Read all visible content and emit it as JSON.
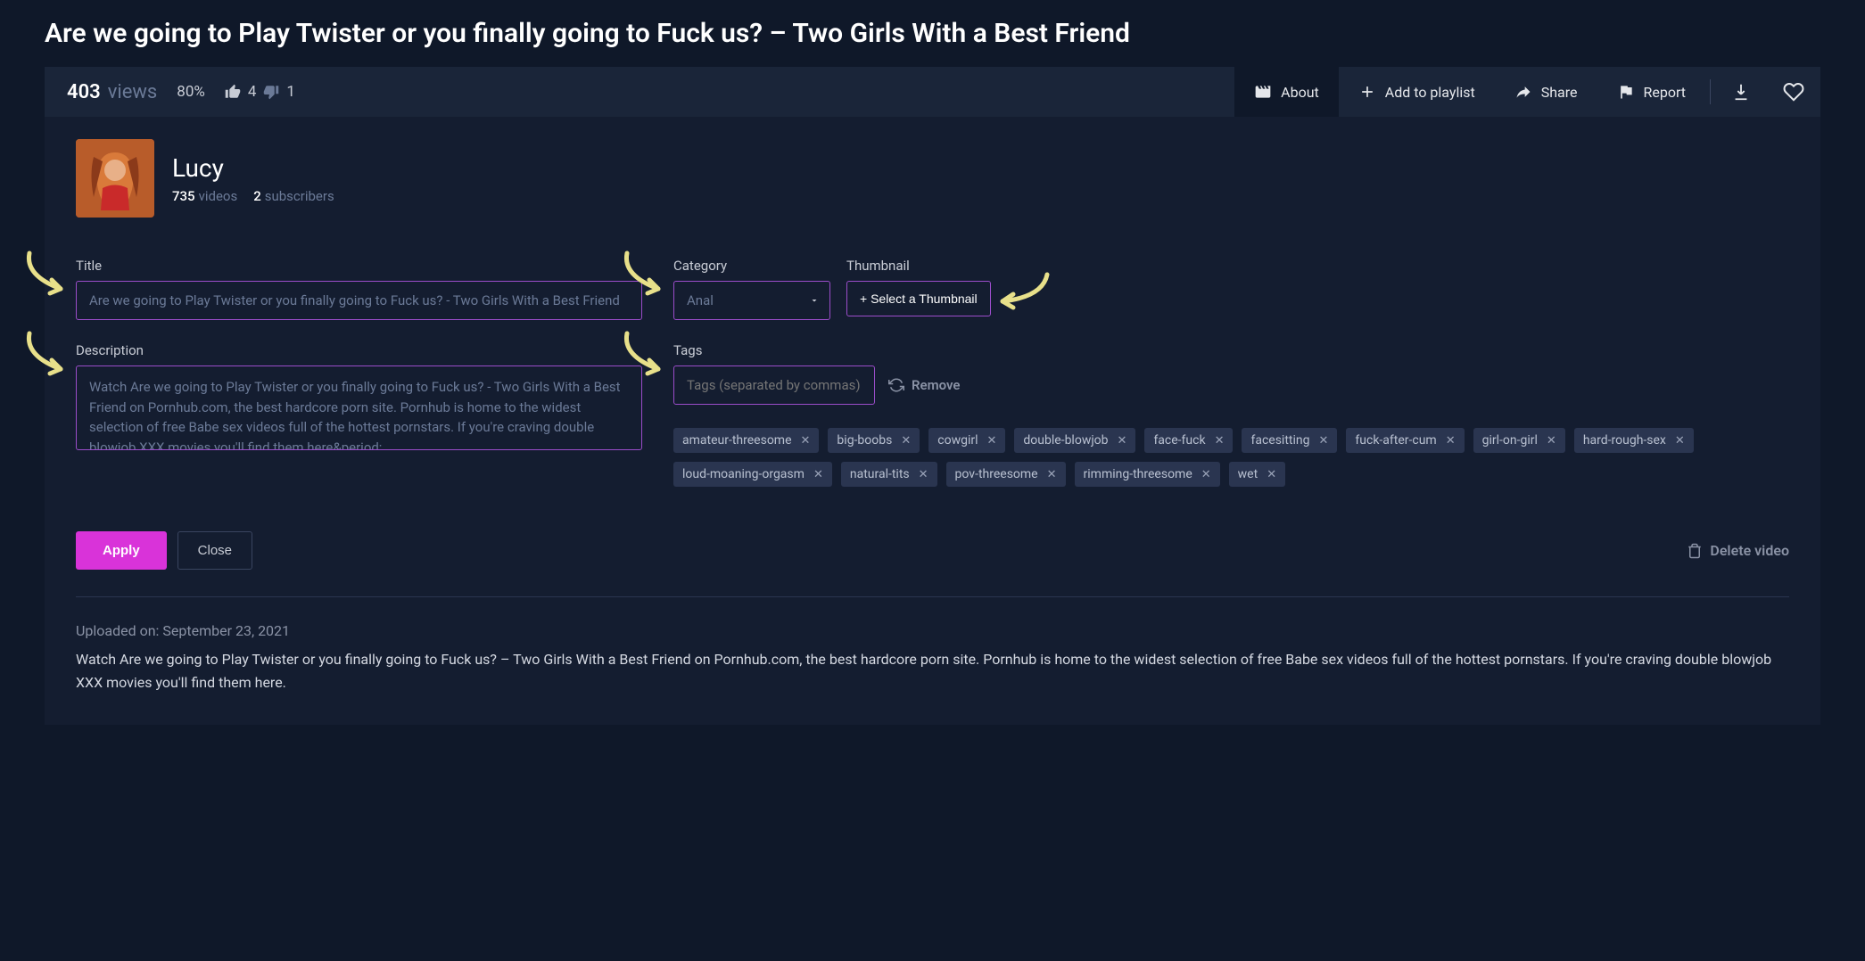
{
  "page": {
    "title": "Are we going to Play Twister or you finally going to Fuck us? – Two Girls With a Best Friend"
  },
  "stats": {
    "views_count": "403",
    "views_label": "views",
    "percent": "80%",
    "likes": "4",
    "dislikes": "1"
  },
  "tabs": {
    "about": "About",
    "add_playlist": "Add to playlist",
    "share": "Share",
    "report": "Report"
  },
  "author": {
    "name": "Lucy",
    "videos_count": "735",
    "videos_label": "videos",
    "subs_count": "2",
    "subs_label": "subscribers"
  },
  "form": {
    "title_label": "Title",
    "title_value": "Are we going to Play Twister or you finally going to Fuck us? - Two Girls With a Best Friend",
    "desc_label": "Description",
    "desc_value": "Watch Are we going to Play Twister or you finally going to Fuck us? - Two Girls With a Best Friend on Pornhub.com, the best hardcore porn site. Pornhub is home to the widest selection of free Babe sex videos full of the hottest pornstars. If you're craving double blowjob XXX movies you'll find them here&period;",
    "category_label": "Category",
    "category_value": "Anal",
    "thumb_label": "Thumbnail",
    "thumb_button": "+ Select a Thumbnail",
    "tags_label": "Tags",
    "tags_placeholder": "Tags (separated by commas)",
    "remove_label": "Remove",
    "tags": [
      "amateur-threesome",
      "big-boobs",
      "cowgirl",
      "double-blowjob",
      "face-fuck",
      "facesitting",
      "fuck-after-cum",
      "girl-on-girl",
      "hard-rough-sex",
      "loud-moaning-orgasm",
      "natural-tits",
      "pov-threesome",
      "rimming-threesome",
      "wet"
    ]
  },
  "actions": {
    "apply": "Apply",
    "close": "Close",
    "delete": "Delete video"
  },
  "meta": {
    "uploaded": "Uploaded on: September 23, 2021",
    "description": "Watch Are we going to Play Twister or you finally going to Fuck us? – Two Girls With a Best Friend on Pornhub.com, the best hardcore porn site. Pornhub is home to the widest selection of free Babe sex videos full of the hottest pornstars. If you're craving double blowjob XXX movies you'll find them here."
  }
}
